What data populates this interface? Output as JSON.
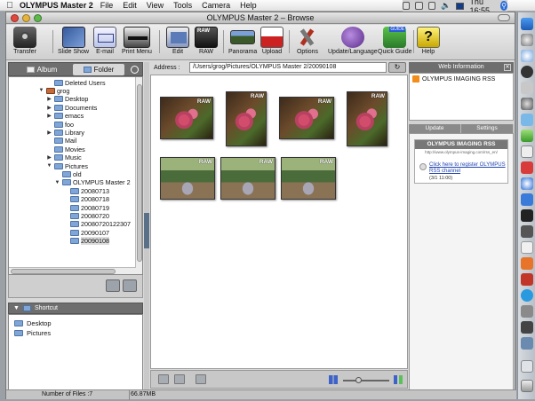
{
  "menubar": {
    "app_name": "OLYMPUS Master 2",
    "items": [
      "File",
      "Edit",
      "View",
      "Tools",
      "Camera",
      "Help"
    ],
    "clock": "Thu 16:55"
  },
  "window": {
    "title": "OLYMPUS Master 2 – Browse"
  },
  "toolbar": {
    "items": [
      {
        "label": "Transfer",
        "icon": "camera-transfer-icon"
      },
      {
        "label": "Slide Show",
        "icon": "slideshow-icon"
      },
      {
        "label": "E-mail",
        "icon": "email-icon"
      },
      {
        "label": "Print Menu",
        "icon": "printer-icon"
      },
      {
        "label": "Edit",
        "icon": "edit-image-icon"
      },
      {
        "label": "RAW",
        "icon": "raw-icon"
      },
      {
        "label": "Panorama",
        "icon": "panorama-icon"
      },
      {
        "label": "Upload",
        "icon": "youtube-upload-icon"
      },
      {
        "label": "Options",
        "icon": "tools-icon"
      },
      {
        "label": "Update/Language",
        "icon": "globe-update-icon"
      },
      {
        "label": "Quick Guide",
        "icon": "quick-guide-icon"
      },
      {
        "label": "Help",
        "icon": "help-icon"
      }
    ]
  },
  "left": {
    "tabs": {
      "album": "Album",
      "folder": "Folder"
    },
    "tree": [
      {
        "label": "Deleted Users",
        "depth": 1,
        "expanded": null
      },
      {
        "label": "grog",
        "depth": 0,
        "expanded": true,
        "icon": "home"
      },
      {
        "label": "Desktop",
        "depth": 1,
        "expanded": false
      },
      {
        "label": "Documents",
        "depth": 1,
        "expanded": false
      },
      {
        "label": "emacs",
        "depth": 1,
        "expanded": false
      },
      {
        "label": "foo",
        "depth": 1,
        "expanded": null
      },
      {
        "label": "Library",
        "depth": 1,
        "expanded": false
      },
      {
        "label": "Mail",
        "depth": 1,
        "expanded": null
      },
      {
        "label": "Movies",
        "depth": 1,
        "expanded": null
      },
      {
        "label": "Music",
        "depth": 1,
        "expanded": false
      },
      {
        "label": "Pictures",
        "depth": 1,
        "expanded": true
      },
      {
        "label": "old",
        "depth": 2,
        "expanded": null
      },
      {
        "label": "OLYMPUS Master 2",
        "depth": 2,
        "expanded": true
      },
      {
        "label": "20080713",
        "depth": 3,
        "expanded": null
      },
      {
        "label": "20080718",
        "depth": 3,
        "expanded": null
      },
      {
        "label": "20080719",
        "depth": 3,
        "expanded": null
      },
      {
        "label": "20080720",
        "depth": 3,
        "expanded": null
      },
      {
        "label": "20080720122307",
        "depth": 3,
        "expanded": null
      },
      {
        "label": "20090107",
        "depth": 3,
        "expanded": null
      },
      {
        "label": "20090108",
        "depth": 3,
        "expanded": null,
        "selected": true
      }
    ],
    "shortcut_title": "Shortcut",
    "shortcuts": [
      "Desktop",
      "Pictures"
    ]
  },
  "address": {
    "label": "Address :",
    "path": "/Users/grog/Pictures/OLYMPUS Master 2/20090108"
  },
  "thumbnails": [
    {
      "type": "flower",
      "badge": "RAW"
    },
    {
      "type": "flower",
      "badge": "RAW"
    },
    {
      "type": "flower",
      "badge": "RAW"
    },
    {
      "type": "flower",
      "badge": "RAW"
    },
    {
      "type": "garden",
      "badge": "RAW"
    },
    {
      "type": "garden",
      "badge": "RAW"
    },
    {
      "type": "garden",
      "badge": "RAW"
    }
  ],
  "web_info": {
    "title": "Web Information",
    "feed_name": "OLYMPUS IMAGING RSS",
    "tabs": [
      "Update",
      "Settings"
    ],
    "box_title": "OLYMPUS IMAGING RSS",
    "box_sub": "http://www.olympus-imaging.com/rss_en/",
    "link_text": "Click here to register OLYMPUS RSS channel",
    "date": "(3/1 11:00)"
  },
  "status": {
    "files": "Number of Files :7",
    "size": "66.87MB"
  },
  "colors": {
    "accent": "#3f62c9",
    "folder": "#7fa6d6",
    "rss": "#f28c1a"
  }
}
